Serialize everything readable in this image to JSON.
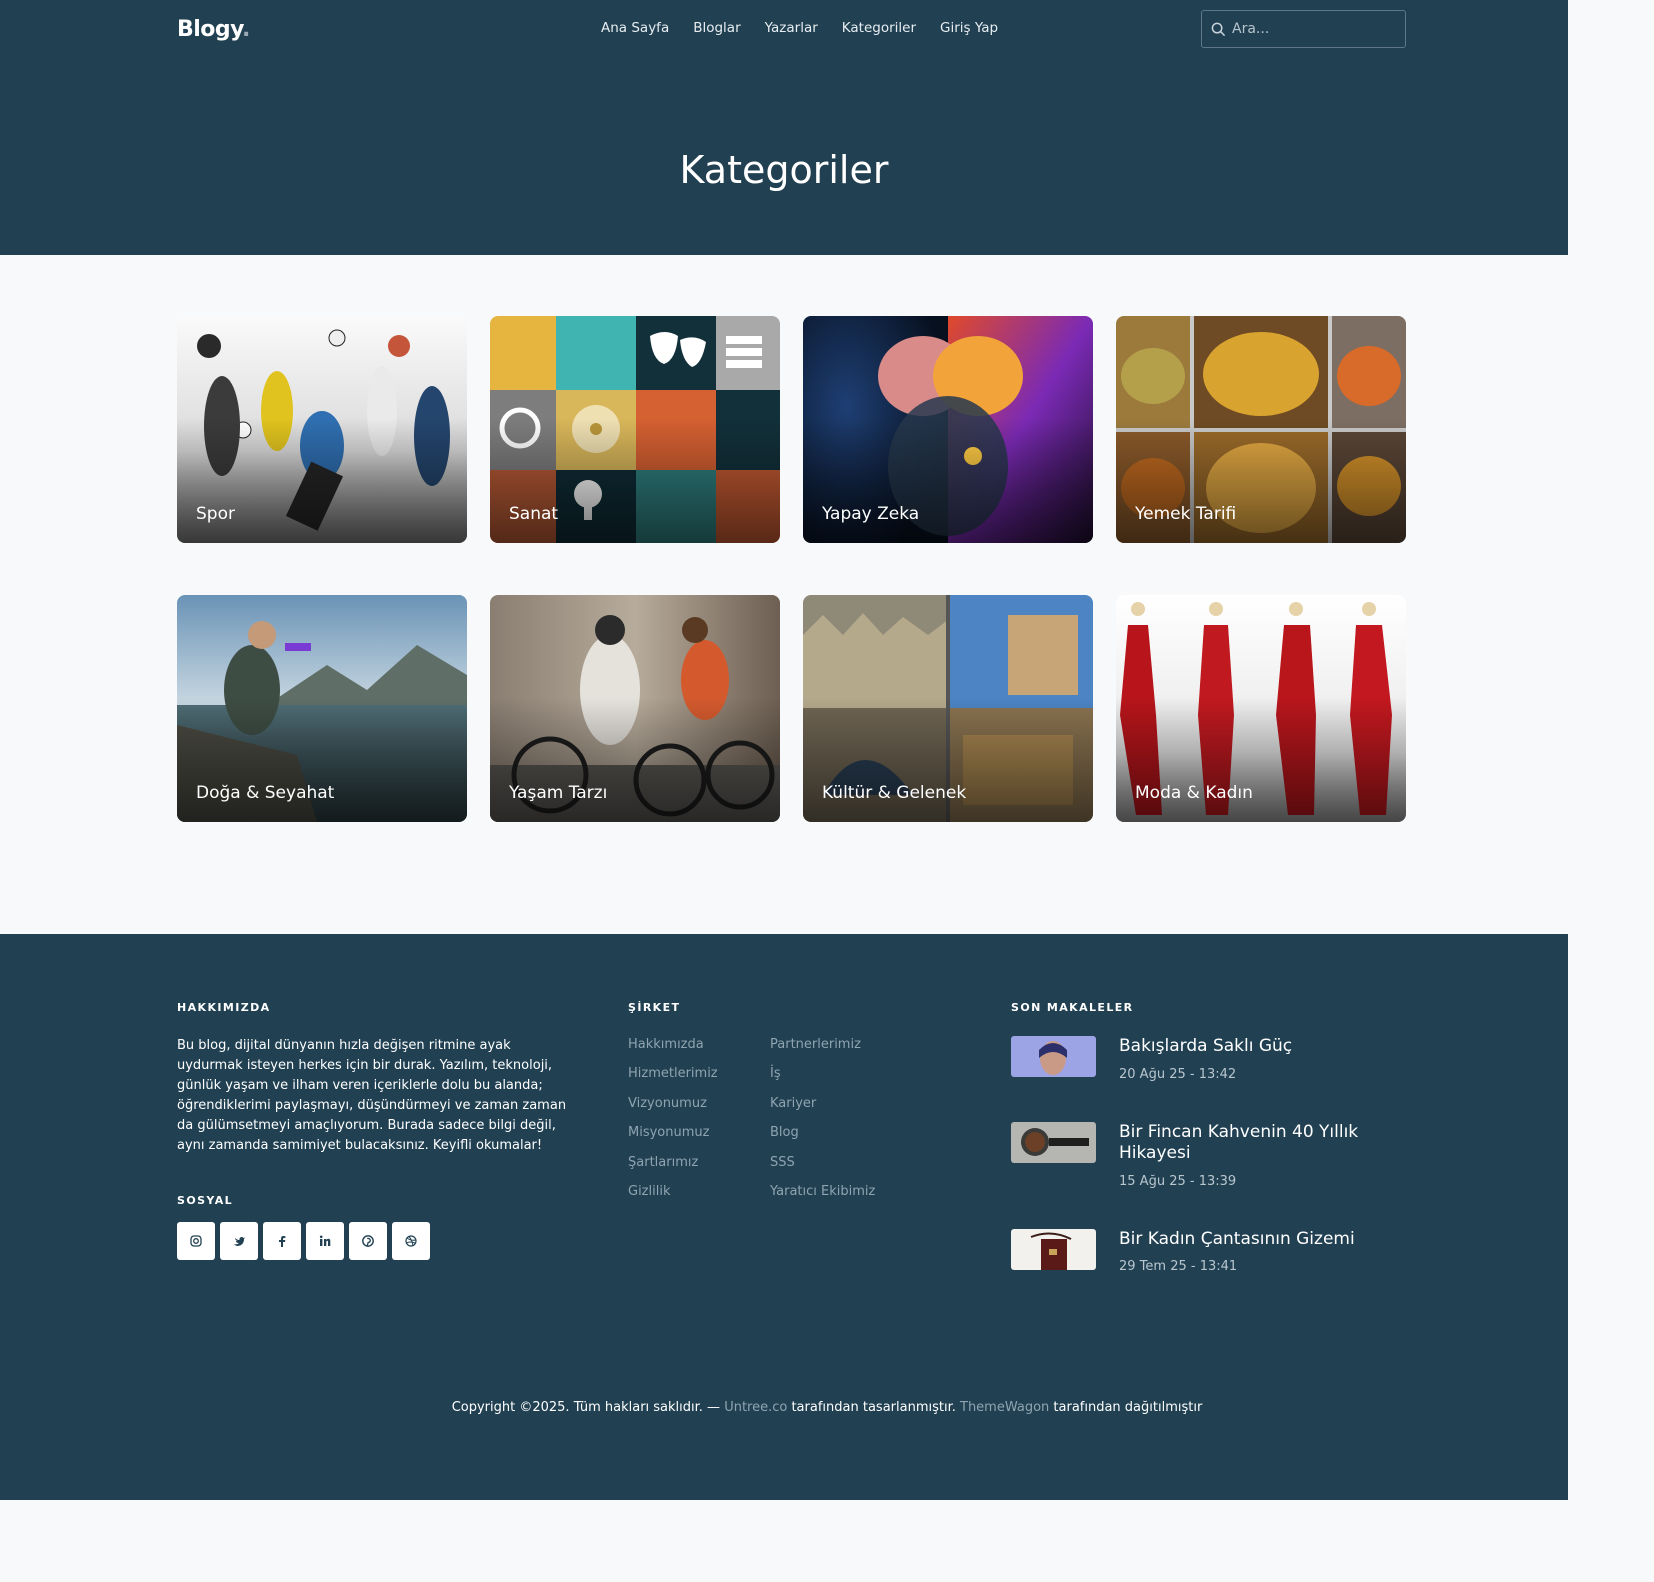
{
  "header": {
    "logo": "Blogy",
    "logo_dot": ".",
    "nav": [
      "Ana Sayfa",
      "Bloglar",
      "Yazarlar",
      "Kategoriler",
      "Giriş Yap"
    ],
    "search_placeholder": "Ara..."
  },
  "page_title": "Kategoriler",
  "categories": [
    {
      "label": "Spor"
    },
    {
      "label": "Sanat"
    },
    {
      "label": "Yapay Zeka"
    },
    {
      "label": "Yemek Tarifi"
    },
    {
      "label": "Doğa & Seyahat"
    },
    {
      "label": "Yaşam Tarzı"
    },
    {
      "label": "Kültür & Gelenek"
    },
    {
      "label": "Moda & Kadın"
    }
  ],
  "footer": {
    "about_heading": "HAKKIMIZDA",
    "about_text": "Bu blog, dijital dünyanın hızla değişen ritmine ayak uydurmak isteyen herkes için bir durak. Yazılım, teknoloji, günlük yaşam ve ilham veren içeriklerle dolu bu alanda; öğrendiklerimi paylaşmayı, düşündürmeyi ve zaman zaman da gülümsetmeyi amaçlıyorum. Burada sadece bilgi değil, aynı zamanda samimiyet bulacaksınız. Keyifli okumalar!",
    "social_heading": "SOSYAL",
    "socials": [
      "instagram-icon",
      "twitter-icon",
      "facebook-icon",
      "linkedin-icon",
      "pinterest-icon",
      "dribbble-icon"
    ],
    "company_heading": "ŞİRKET",
    "company_col1": [
      "Hakkımızda",
      "Hizmetlerimiz",
      "Vizyonumuz",
      "Misyonumuz",
      "Şartlarımız",
      "Gizlilik"
    ],
    "company_col2": [
      "Partnerlerimiz",
      "İş",
      "Kariyer",
      "Blog",
      "SSS",
      "Yaratıcı Ekibimiz"
    ],
    "recent_heading": "SON MAKALELER",
    "recent": [
      {
        "title": "Bakışlarda Saklı Güç",
        "date": "20 Ağu 25 - 13:42"
      },
      {
        "title": "Bir Fincan Kahvenin 40 Yıllık Hikayesi",
        "date": "15 Ağu 25 - 13:39"
      },
      {
        "title": "Bir Kadın Çantasının Gizemi",
        "date": "29 Tem 25 - 13:41"
      }
    ],
    "copyright_prefix": "Copyright ©2025. Tüm hakları saklıdır. — ",
    "designer_link": "Untree.co",
    "designer_suffix": " tarafından tasarlanmıştır. ",
    "distributor_link": "ThemeWagon",
    "distributor_suffix": " tarafından dağıtılmıştır"
  },
  "colors": {
    "header_bg": "#214153",
    "page_bg": "#f8f9fb",
    "footer_bg": "#214153",
    "muted_link": "#8fa3b0"
  }
}
